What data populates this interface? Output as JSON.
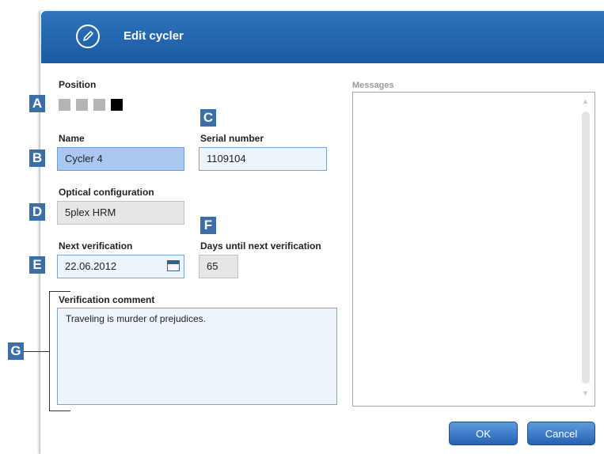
{
  "dialog": {
    "title": "Edit cycler",
    "title_icon": "pencil-icon"
  },
  "position": {
    "label": "Position",
    "slots": [
      {
        "state": "unavailable",
        "color": "#b5b5b5"
      },
      {
        "state": "unavailable",
        "color": "#b5b5b5"
      },
      {
        "state": "unavailable",
        "color": "#b5b5b5"
      },
      {
        "state": "selected",
        "color": "#000000"
      }
    ]
  },
  "name": {
    "label": "Name",
    "value": "Cycler 4"
  },
  "serial_number": {
    "label": "Serial number",
    "value": "1109104"
  },
  "optical_configuration": {
    "label": "Optical configuration",
    "value": "5plex HRM"
  },
  "next_verification": {
    "label": "Next verification",
    "value": "22.06.2012",
    "icon": "calendar-icon"
  },
  "days_until_next_verification": {
    "label": "Days until next verification",
    "value": "65"
  },
  "verification_comment": {
    "label": "Verification comment",
    "value": "Traveling is murder of prejudices."
  },
  "messages": {
    "label": "Messages"
  },
  "buttons": {
    "ok": "OK",
    "cancel": "Cancel"
  },
  "markers": {
    "a": "A",
    "b": "B",
    "c": "C",
    "d": "D",
    "e": "E",
    "f": "F",
    "g": "G"
  },
  "colors": {
    "header": "#1f63ad",
    "marker": "#3c6fa8",
    "button": "#2f6fc0"
  }
}
